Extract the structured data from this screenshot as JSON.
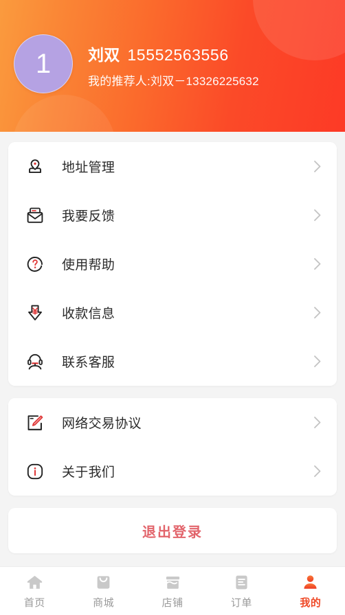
{
  "theme": {
    "gradient_start": "#FA9B3E",
    "gradient_end": "#FD3A26",
    "avatar_bg": "#B5A2E3",
    "accent_red": "#E2646B",
    "active_tab_color": "#EF4A28",
    "icon_accent": "#E03A3A",
    "page_bg": "#F4F4F4",
    "card_bg": "#FFFFFF"
  },
  "header": {
    "avatar_text": "1",
    "name": "刘双",
    "phone": "15552563556",
    "referrer_line": "我的推荐人:刘双－13326225632"
  },
  "menu_groups": [
    {
      "group_name": "account-services",
      "items": [
        {
          "icon": "location-pin-icon",
          "label": "地址管理",
          "chevron": "chevron-right-icon"
        },
        {
          "icon": "envelope-feedback-icon",
          "label": "我要反馈",
          "chevron": "chevron-right-icon"
        },
        {
          "icon": "question-help-icon",
          "label": "使用帮助",
          "chevron": "chevron-right-icon"
        },
        {
          "icon": "payment-arrow-yuan-icon",
          "label": "收款信息",
          "chevron": "chevron-right-icon"
        },
        {
          "icon": "headset-support-icon",
          "label": "联系客服",
          "chevron": "chevron-right-icon"
        }
      ]
    },
    {
      "group_name": "legal-info",
      "items": [
        {
          "icon": "document-edit-icon",
          "label": "网络交易协议",
          "chevron": "chevron-right-icon"
        },
        {
          "icon": "info-circle-icon",
          "label": "关于我们",
          "chevron": "chevron-right-icon"
        }
      ]
    }
  ],
  "logout": {
    "label": "退出登录"
  },
  "tabbar": {
    "items": [
      {
        "icon": "home-icon",
        "label": "首页",
        "active": false
      },
      {
        "icon": "mall-bag-icon",
        "label": "商城",
        "active": false
      },
      {
        "icon": "shop-store-icon",
        "label": "店铺",
        "active": false
      },
      {
        "icon": "order-list-icon",
        "label": "订单",
        "active": false
      },
      {
        "icon": "user-profile-icon",
        "label": "我的",
        "active": true
      }
    ]
  }
}
